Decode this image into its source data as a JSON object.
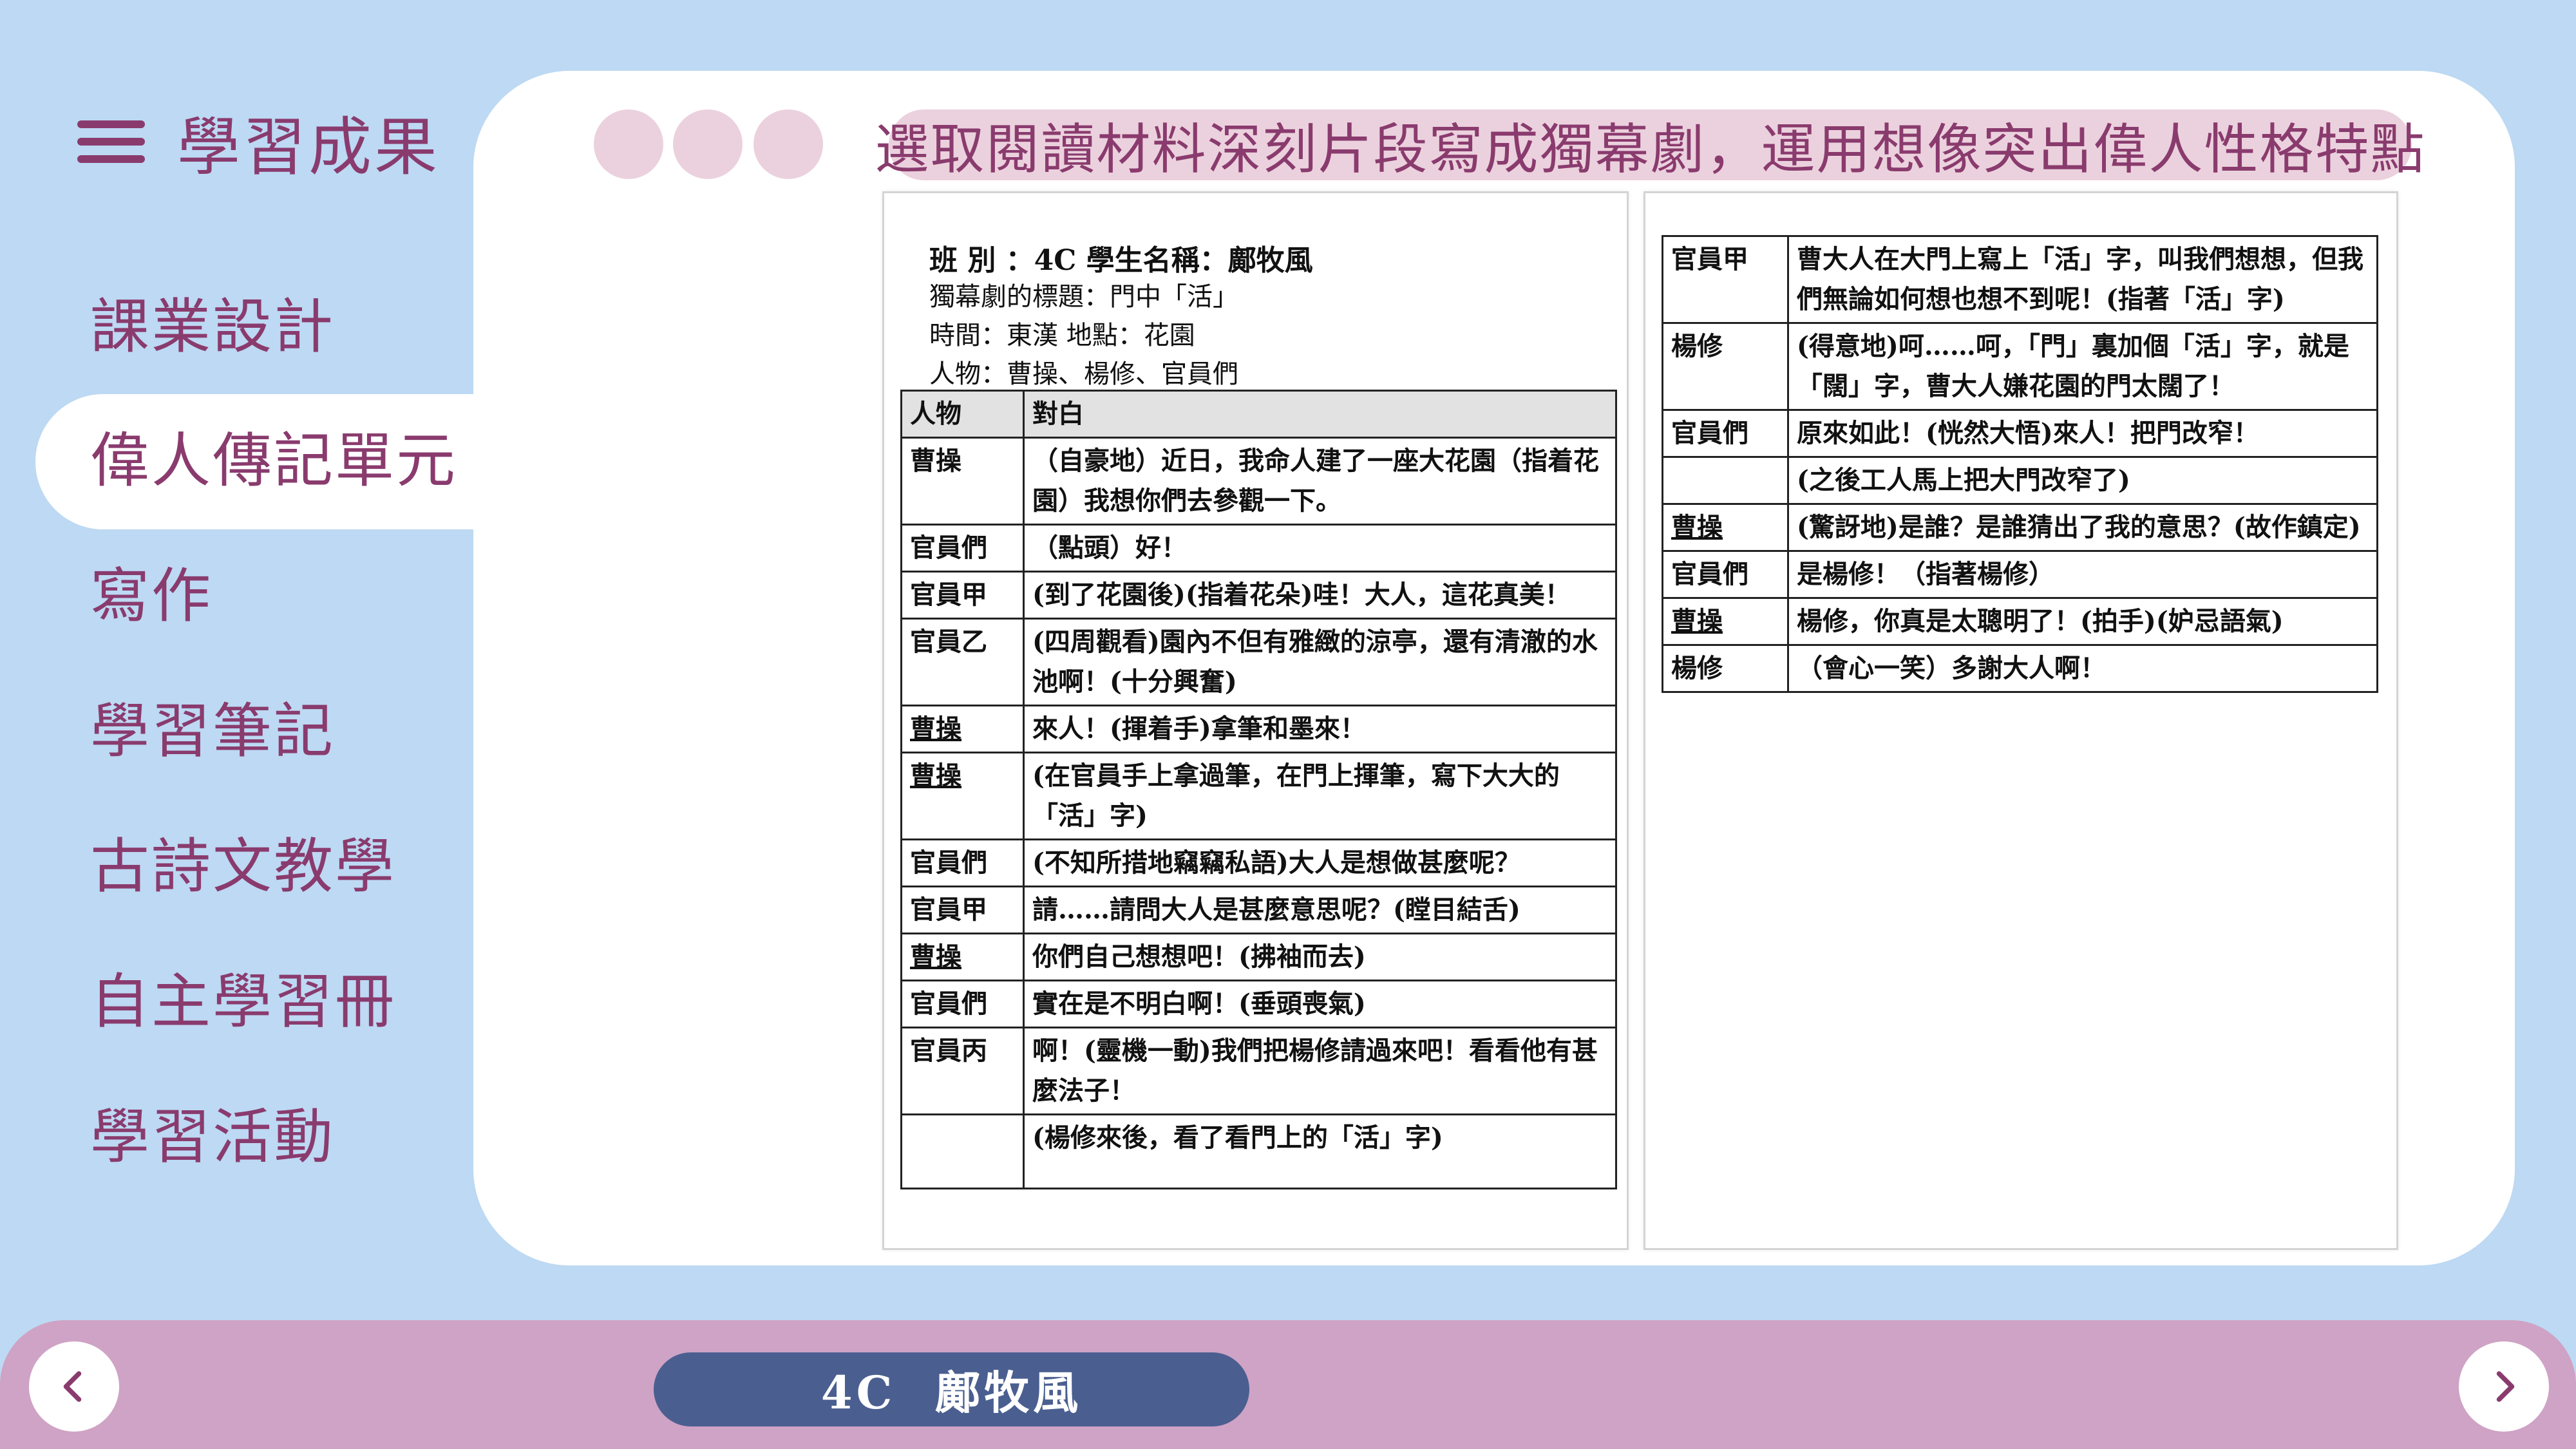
{
  "sidebar": {
    "heading": "學習成果",
    "items": [
      {
        "label": "課業設計"
      },
      {
        "label": "偉人傳記單元"
      },
      {
        "label": "寫作"
      },
      {
        "label": "學習筆記"
      },
      {
        "label": "古詩文教學"
      },
      {
        "label": "自主學習冊"
      },
      {
        "label": "學習活動"
      }
    ],
    "active_index": 1
  },
  "main": {
    "title": "選取閱讀材料深刻片段寫成獨幕劇，運用想像突出偉人性格特點"
  },
  "document": {
    "header": "班 別 ：4C   學生名稱：鄺牧風",
    "lines": [
      "獨幕劇的標題：門中「活」",
      "時間：東漢   地點：花園",
      "人物：曹操、楊修、官員們"
    ],
    "table_headers": [
      "人物",
      "對白"
    ],
    "left_rows": [
      {
        "role": "曹操",
        "line": "（自豪地）近日，我命人建了一座大花園（指着花園）我想你們去參觀一下。"
      },
      {
        "role": "官員們",
        "line": "（點頭）好！"
      },
      {
        "role": "官員甲",
        "line": "(到了花園後)(指着花朵)哇！大人，這花真美！"
      },
      {
        "role": "官員乙",
        "line": "(四周觀看)園內不但有雅緻的涼亭，還有清澈的水池啊！(十分興奮)"
      },
      {
        "role": "曹操",
        "line": "來人！(揮着手)拿筆和墨來！"
      },
      {
        "role": "曹操",
        "line": "(在官員手上拿過筆，在門上揮筆，寫下大大的「活」字)"
      },
      {
        "role": "官員們",
        "line": "(不知所措地竊竊私語)大人是想做甚麼呢？"
      },
      {
        "role": "官員甲",
        "line": "請……請問大人是甚麼意思呢？(瞠目結舌)"
      },
      {
        "role": "曹操",
        "line": "你們自己想想吧！(拂袖而去)"
      },
      {
        "role": "官員們",
        "line": "實在是不明白啊！(垂頭喪氣)"
      },
      {
        "role": "官員丙",
        "line": "啊！(靈機一動)我們把楊修請過來吧！看看他有甚麼法子！"
      },
      {
        "role": "",
        "line": "(楊修來後，看了看門上的「活」字)"
      }
    ],
    "right_rows": [
      {
        "role": "官員甲",
        "line": "曹大人在大門上寫上「活」字，叫我們想想，但我們無論如何想也想不到呢！(指著「活」字)"
      },
      {
        "role": "楊修",
        "line": "(得意地)呵……呵，「門」裏加個「活」字，就是「闊」字，曹大人嫌花園的門太闊了！"
      },
      {
        "role": "官員們",
        "line": "原來如此！(恍然大悟)來人！把門改窄！"
      },
      {
        "role": "",
        "line": "(之後工人馬上把大門改窄了)"
      },
      {
        "role": "曹操",
        "line": "(驚訝地)是誰？是誰猜出了我的意思？(故作鎮定)"
      },
      {
        "role": "官員們",
        "line": "是楊修！（指著楊修）"
      },
      {
        "role": "曹操",
        "line": "楊修，你真是太聰明了！(拍手)(妒忌語氣)"
      },
      {
        "role": "楊修",
        "line": "（會心一笑）多謝大人啊！"
      }
    ]
  },
  "footer": {
    "student_label": "4C  鄺牧風",
    "prev_icon": "chevron-left-icon",
    "next_icon": "chevron-right-icon"
  },
  "colors": {
    "background": "#bdd9f3",
    "accent": "#8a3b6e",
    "pill": "#ebd1dd",
    "bottom_bar": "#cfa3c5",
    "name_pill": "#4a5f90"
  }
}
